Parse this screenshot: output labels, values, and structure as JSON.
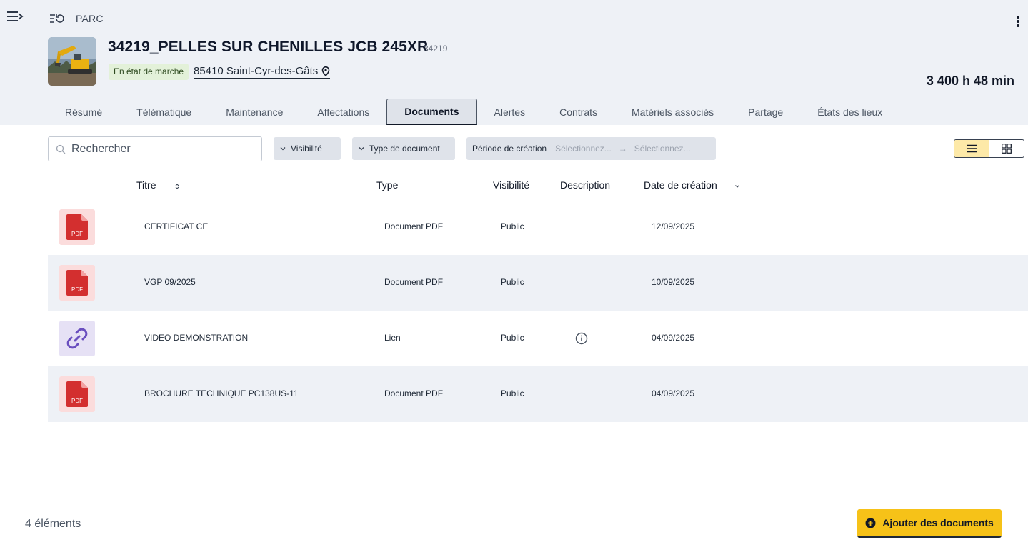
{
  "breadcrumb": {
    "label": "PARC"
  },
  "equipment": {
    "title": "34219_PELLES SUR CHENILLES JCB 245XR",
    "code": "34219",
    "status": "En état de marche",
    "location": "85410 Saint-Cyr-des-Gâts",
    "hours": "3 400 h 48 min"
  },
  "tabs": [
    {
      "label": "Résumé"
    },
    {
      "label": "Télématique"
    },
    {
      "label": "Maintenance"
    },
    {
      "label": "Affectations"
    },
    {
      "label": "Documents",
      "active": true
    },
    {
      "label": "Alertes"
    },
    {
      "label": "Contrats"
    },
    {
      "label": "Matériels associés"
    },
    {
      "label": "Partage"
    },
    {
      "label": "États des lieux"
    }
  ],
  "filters": {
    "search_placeholder": "Rechercher",
    "visibility": "Visibilité",
    "doc_type": "Type de document",
    "period_label": "Période de création",
    "period_start_placeholder": "Sélectionnez...",
    "period_end_placeholder": "Sélectionnez..."
  },
  "table": {
    "headers": {
      "title": "Titre",
      "type": "Type",
      "visibility": "Visibilité",
      "description": "Description",
      "created": "Date de création"
    },
    "rows": [
      {
        "icon": "pdf-file-icon",
        "icon_text": "PDF",
        "title": "CERTIFICAT CE",
        "type": "Document PDF",
        "visibility": "Public",
        "has_description": false,
        "date": "12/09/2025"
      },
      {
        "icon": "pdf-file-icon",
        "icon_text": "PDF",
        "title": "VGP 09/2025",
        "type": "Document PDF",
        "visibility": "Public",
        "has_description": false,
        "date": "10/09/2025"
      },
      {
        "icon": "link-icon",
        "title": "VIDEO DEMONSTRATION",
        "type": "Lien",
        "visibility": "Public",
        "has_description": true,
        "date": "04/09/2025"
      },
      {
        "icon": "pdf-file-icon",
        "icon_text": "PDF",
        "title": "BROCHURE TECHNIQUE PC138US-11",
        "type": "Document PDF",
        "visibility": "Public",
        "has_description": false,
        "date": "04/09/2025"
      }
    ]
  },
  "footer": {
    "count": "4 éléments",
    "add_button": "Ajouter des documents"
  },
  "colors": {
    "accent": "#f6c218",
    "header_bg": "#eef1f6",
    "pdf_red": "#d32f2f",
    "link_purple": "#6a4fbf",
    "status_green_bg": "#e3f1d9"
  }
}
